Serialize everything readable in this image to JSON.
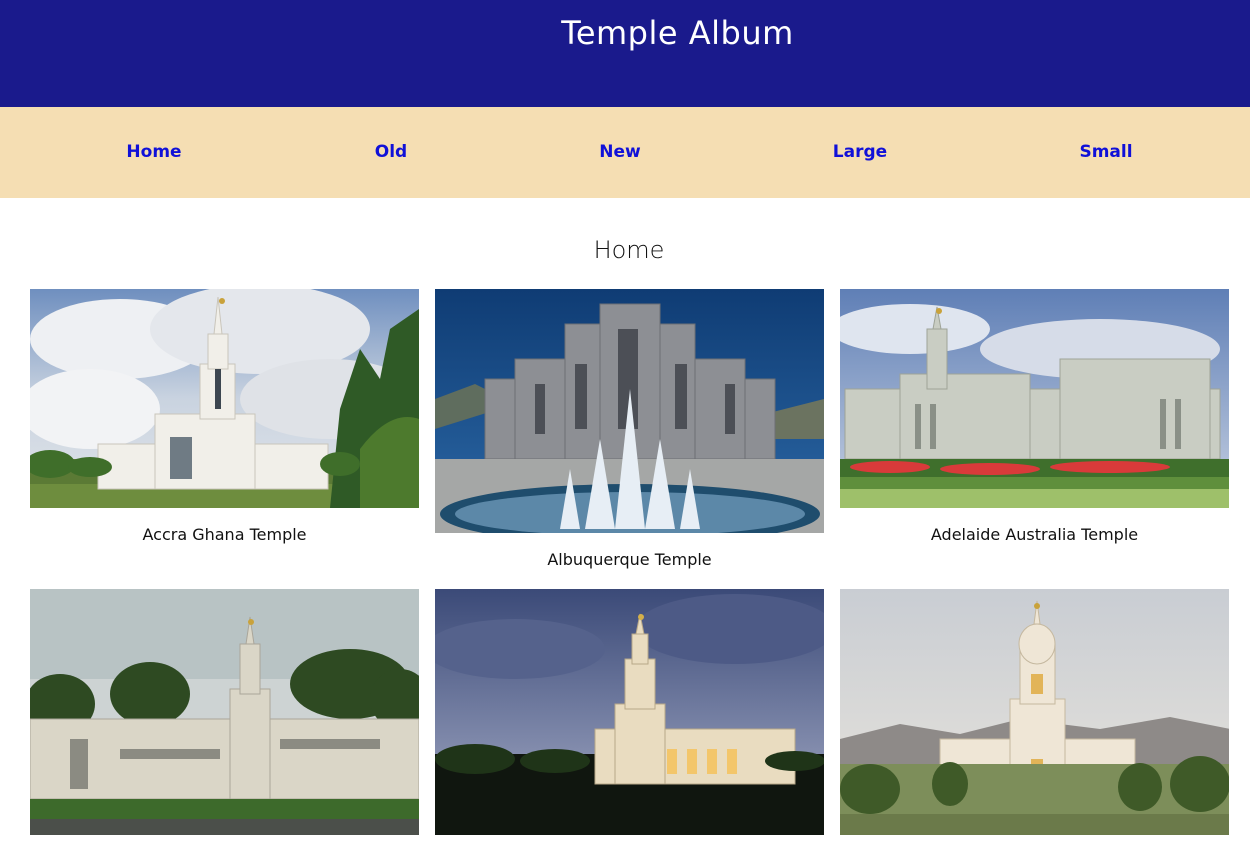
{
  "header": {
    "title": "Temple Album"
  },
  "nav": {
    "items": [
      {
        "label": "Home"
      },
      {
        "label": "Old"
      },
      {
        "label": "New"
      },
      {
        "label": "Large"
      },
      {
        "label": "Small"
      }
    ]
  },
  "main": {
    "title": "Home",
    "temples": [
      {
        "name": "Accra Ghana Temple"
      },
      {
        "name": "Albuquerque Temple"
      },
      {
        "name": "Adelaide Australia Temple"
      },
      {
        "name": ""
      },
      {
        "name": ""
      },
      {
        "name": ""
      }
    ]
  },
  "colors": {
    "header_bg": "#1a1a8c",
    "nav_bg": "#f5deb3",
    "nav_link": "#1010d8",
    "page_bg": "#ffffff"
  }
}
